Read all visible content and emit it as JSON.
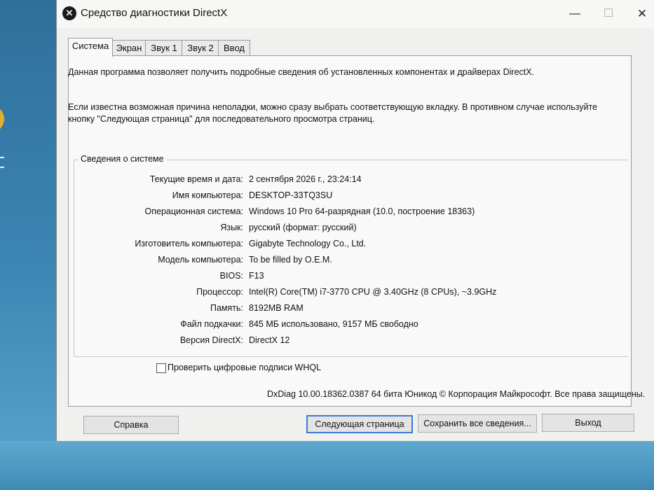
{
  "window": {
    "title": "Средство диагностики DirectX"
  },
  "controls": {
    "minimize": "—",
    "maximize": "☐",
    "close": "✕"
  },
  "tabs": [
    "Система",
    "Экран",
    "Звук 1",
    "Звук 2",
    "Ввод"
  ],
  "active_tab": "Система",
  "intro": {
    "line1": "Данная программа позволяет получить подробные сведения об установленных компонентах и драйверах DirectX.",
    "line2": "Если известна возможная причина неполадки, можно сразу выбрать соответствующую вкладку. В противном случае используйте кнопку \"Следующая страница\" для последовательного просмотра страниц."
  },
  "system_info": {
    "title": "Сведения о системе",
    "rows": [
      {
        "label": "Текущие время и дата:",
        "value": "2 сентября 2026 г., 23:24:14"
      },
      {
        "label": "Имя компьютера:",
        "value": "DESKTOP-33TQ3SU"
      },
      {
        "label": "Операционная система:",
        "value": "Windows 10 Pro 64-разрядная (10.0, построение 18363)"
      },
      {
        "label": "Язык:",
        "value": "русский (формат: русский)"
      },
      {
        "label": "Изготовитель компьютера:",
        "value": "Gigabyte Technology Co., Ltd."
      },
      {
        "label": "Модель компьютера:",
        "value": "To be filled by O.E.M."
      },
      {
        "label": "BIOS:",
        "value": "F13"
      },
      {
        "label": "Процессор:",
        "value": "Intel(R) Core(TM) i7-3770 CPU @ 3.40GHz (8 CPUs), ~3.9GHz"
      },
      {
        "label": "Память:",
        "value": "8192MB RAM"
      },
      {
        "label": "Файл подкачки:",
        "value": "845 МБ использовано, 9157 МБ свободно"
      },
      {
        "label": "Версия DirectX:",
        "value": "DirectX 12"
      }
    ]
  },
  "whql_checkbox": {
    "label": "Проверить цифровые подписи WHQL",
    "checked": false
  },
  "copyright": "DxDiag 10.00.18362.0387 64 бита Юникод © Корпорация Майкрософт. Все права защищены.",
  "buttons": {
    "help": "Справка",
    "next_page": "Следующая страница",
    "save_all": "Сохранить все сведения...",
    "exit": "Выход"
  },
  "colors": {
    "desktop": "#4a8fb8",
    "window_bg": "#f0f0ee",
    "panel_bg": "#f9f9f9",
    "default_button_border": "#3a7bd5"
  },
  "icons": {
    "app": "dxdiag-icon"
  }
}
